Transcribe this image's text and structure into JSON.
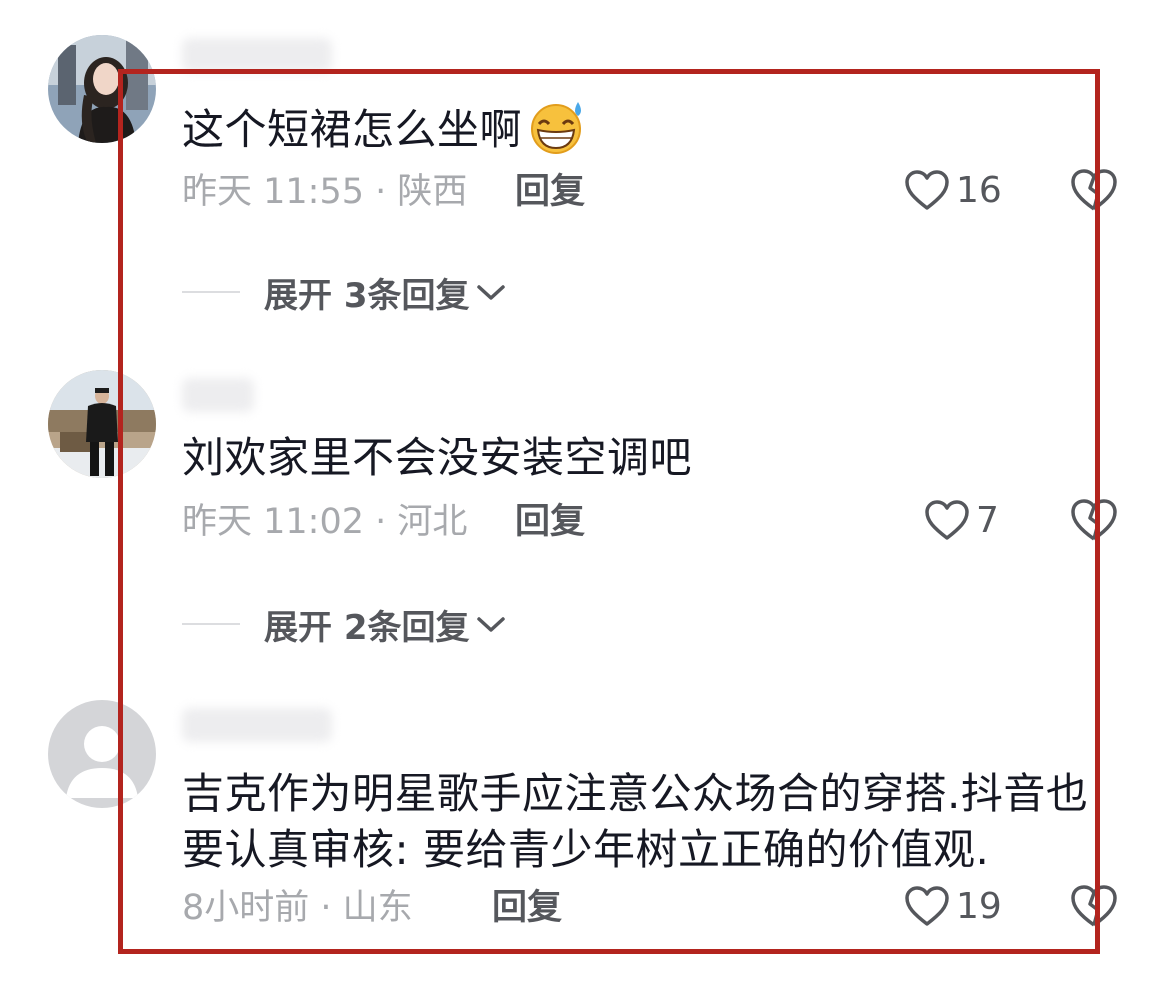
{
  "comments": [
    {
      "text": "这个短裙怎么坐啊",
      "time_location": "昨天 11:55 · 陕西",
      "reply_label": "回复",
      "likes": "16",
      "expand_label": "展开 3条回复"
    },
    {
      "text": "刘欢家里不会没安装空调吧",
      "time_location": "昨天 11:02 · 河北",
      "reply_label": "回复",
      "likes": "7",
      "expand_label": "展开 2条回复"
    },
    {
      "text": "吉克作为明星歌手应注意公众场合的穿搭.抖音也要认真审核: 要给青少年树立正确的价值观.",
      "time_location": "8小时前 · 山东",
      "reply_label": "回复",
      "likes": "19"
    }
  ],
  "icons": {
    "like": "heart-outline-icon",
    "dislike": "broken-heart-outline-icon",
    "expand": "chevron-down-icon",
    "emoji": "grinning-sweat-emoji"
  },
  "colors": {
    "highlight_frame": "#b3241e",
    "meta_text": "#a7a9ad",
    "action_text": "#55575c"
  }
}
